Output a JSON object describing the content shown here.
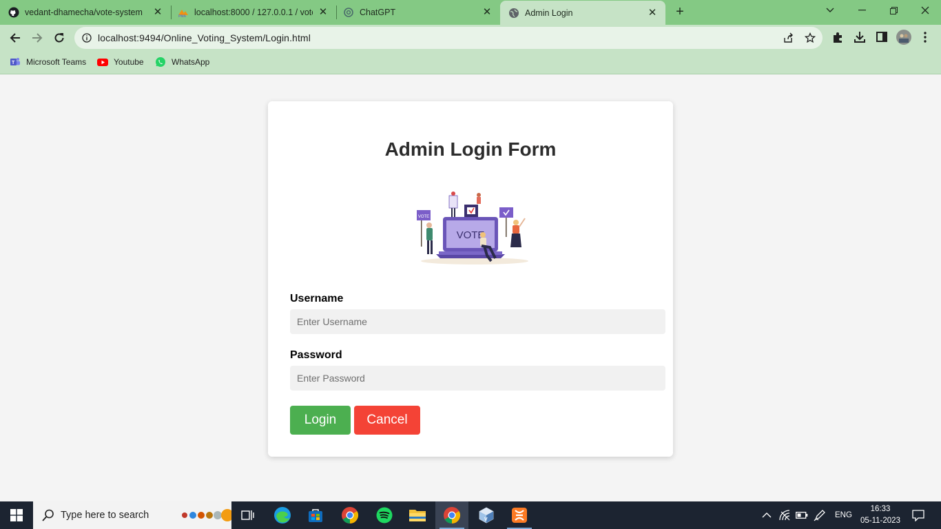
{
  "browser": {
    "tabs": [
      {
        "title": "vedant-dhamecha/vote-system",
        "icon": "github-icon"
      },
      {
        "title": "localhost:8000 / 127.0.0.1 / vote",
        "icon": "phpmyadmin-icon"
      },
      {
        "title": "ChatGPT",
        "icon": "chatgpt-icon"
      },
      {
        "title": "Admin Login",
        "icon": "globe-icon",
        "active": true
      }
    ],
    "url": "localhost:9494/Online_Voting_System/Login.html",
    "bookmarks": [
      {
        "label": "Microsoft Teams",
        "icon": "teams-icon"
      },
      {
        "label": "Youtube",
        "icon": "youtube-icon"
      },
      {
        "label": "WhatsApp",
        "icon": "whatsapp-icon"
      }
    ]
  },
  "page": {
    "title": "Admin Login Form",
    "illustration_text": "VOTE",
    "username": {
      "label": "Username",
      "placeholder": "Enter Username",
      "value": ""
    },
    "password": {
      "label": "Password",
      "placeholder": "Enter Password",
      "value": ""
    },
    "login_label": "Login",
    "cancel_label": "Cancel"
  },
  "taskbar": {
    "search_placeholder": "Type here to search",
    "apps": [
      "task-view",
      "edge",
      "store",
      "chrome",
      "spotify",
      "file-explorer",
      "chrome-active",
      "virtualbox",
      "xampp"
    ],
    "lang": "ENG",
    "time": "16:33",
    "date": "05-11-2023"
  },
  "colors": {
    "chrome_tabbar": "#84c984",
    "chrome_toolbar": "#c6e3c6",
    "login_button": "#4caf50",
    "cancel_button": "#f44336",
    "taskbar": "#1c2431"
  }
}
